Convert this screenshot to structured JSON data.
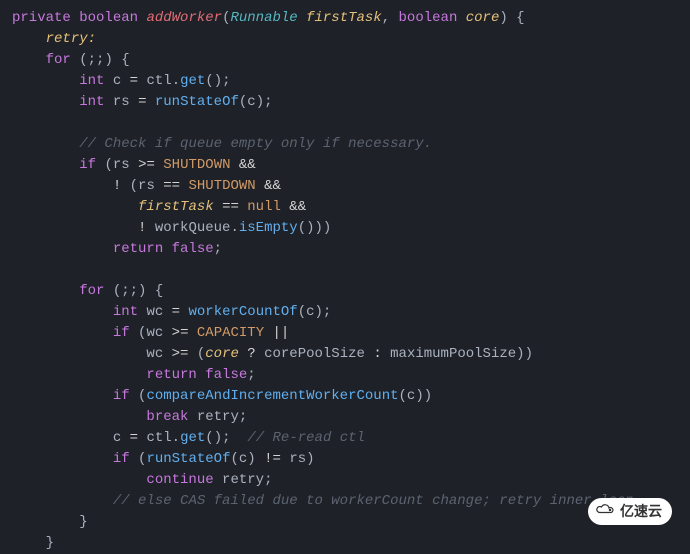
{
  "code": {
    "modifier": "private",
    "returnType": "boolean",
    "methodName": "addWorker",
    "paramType1": "Runnable",
    "paramName1": "firstTask",
    "paramType2": "boolean",
    "paramName2": "core",
    "label_retry": "retry",
    "kw_for": "for",
    "kw_int": "int",
    "kw_if": "if",
    "kw_return": "return",
    "kw_break": "break",
    "kw_continue": "continue",
    "kw_false": "false",
    "kw_null": "null",
    "var_c": "c",
    "var_rs": "rs",
    "var_wc": "wc",
    "field_ctl": "ctl",
    "call_get": "get",
    "call_runStateOf": "runStateOf",
    "call_workerCountOf": "workerCountOf",
    "call_isEmpty": "isEmpty",
    "call_compareAndIncrementWorkerCount": "compareAndIncrementWorkerCount",
    "field_firstTask": "firstTask",
    "field_workQueue": "workQueue",
    "field_core": "core",
    "const_SHUTDOWN": "SHUTDOWN",
    "const_CAPACITY": "CAPACITY",
    "field_corePoolSize": "corePoolSize",
    "field_maximumPoolSize": "maximumPoolSize",
    "comment_queue": "// Check if queue empty only if necessary.",
    "comment_reread": "// Re-read ctl",
    "comment_cas": "// else CAS failed due to workerCount change; retry inner loop"
  },
  "watermark": {
    "text": "亿速云"
  }
}
